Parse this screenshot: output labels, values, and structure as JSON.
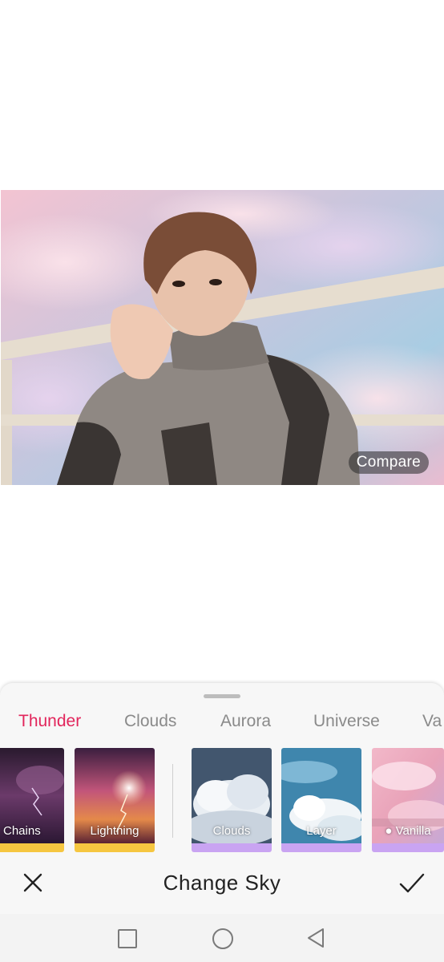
{
  "photo": {
    "compare_label": "Compare"
  },
  "tabs": [
    {
      "label": "Thunder",
      "active": true
    },
    {
      "label": "Clouds",
      "active": false
    },
    {
      "label": "Aurora",
      "active": false
    },
    {
      "label": "Universe",
      "active": false
    },
    {
      "label": "Va",
      "active": false
    }
  ],
  "thumbnails": [
    {
      "label": "Chains",
      "bar_color": "#f6c640"
    },
    {
      "label": "Lightning",
      "bar_color": "#f6c640"
    },
    {
      "label": "Clouds",
      "bar_color": "#c9a4f2"
    },
    {
      "label": "Layer",
      "bar_color": "#c9a4f2"
    },
    {
      "label": "● Vanilla",
      "bar_color": "#c9a4f2"
    }
  ],
  "action_bar": {
    "title": "Change Sky",
    "close_icon": "close-icon",
    "confirm_icon": "check-icon"
  },
  "colors": {
    "accent": "#e2265c",
    "tab_inactive": "#8a8a8a"
  }
}
